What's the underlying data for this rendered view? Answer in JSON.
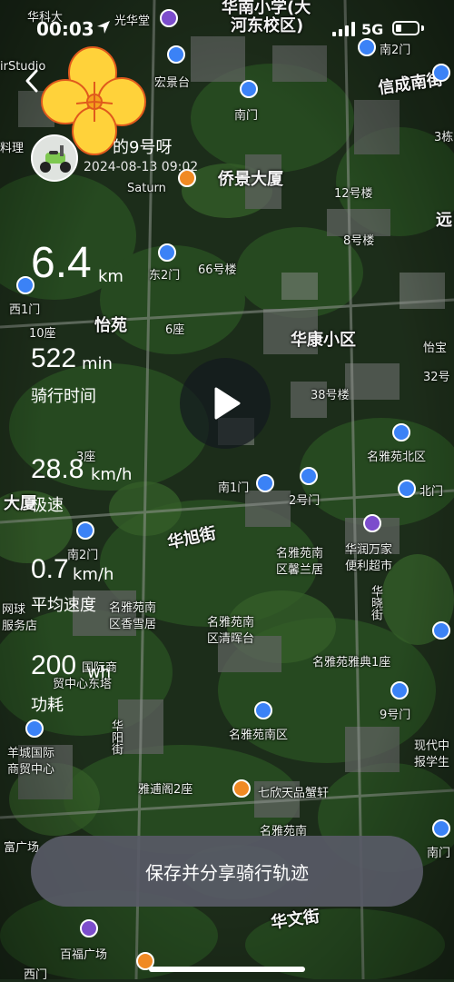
{
  "status_bar": {
    "time": "00:03",
    "network": "5G",
    "battery_level": 0.25
  },
  "header": {
    "user_name": "的9号呀",
    "ride_datetime": "2024-08-13 09:02"
  },
  "stats": [
    {
      "value": "6.4",
      "unit": "km",
      "label": ""
    },
    {
      "value": "522",
      "unit": "min",
      "label": "骑行时间"
    },
    {
      "value": "28.8",
      "unit": "km/h",
      "label": "极速"
    },
    {
      "value": "0.7",
      "unit": "km/h",
      "label": "平均速度"
    },
    {
      "value": "200",
      "unit": "wh",
      "label": "功耗"
    }
  ],
  "actions": {
    "save_share": "保存并分享骑行轨迹"
  },
  "icons": {
    "back": "chevron-left-icon",
    "flower": "flower-sticker-icon",
    "play": "play-icon",
    "location": "location-arrow-icon"
  },
  "colors": {
    "button_bg": "#585a66",
    "map_green": "#2e5a2a",
    "pin_blue": "#3b82f6",
    "pin_orange": "#f08a24",
    "pin_purple": "#7c4dcc"
  },
  "map_labels": {
    "l1": "华科大",
    "l2": "光华堂",
    "l3": "华南小学(大",
    "l4": "河东校区)",
    "l5": "南2门",
    "l6": "宏景台",
    "l7": "信成南街",
    "l8": "南门",
    "l9": "3栋",
    "l10": "料理",
    "l11": "Saturn",
    "l12": "侨景大厦",
    "l13": "12号楼",
    "l14": "远",
    "l15": "8号楼",
    "l16": "东2门",
    "l17": "66号楼",
    "l18": "西1门",
    "l19": "10座",
    "l20": "怡苑",
    "l21": "6座",
    "l22": "华康小区",
    "l23": "怡宝",
    "l24": "32号",
    "l25": "38号楼",
    "l26": "名雅苑北区",
    "l27": "3座",
    "l28": "南1门",
    "l29": "2号门",
    "l30": "北门",
    "l31": "大厦",
    "l32": "华旭街",
    "l33": "南2门",
    "l34": "名雅苑南",
    "l35": "区馨兰居",
    "l36": "华润万家",
    "l37": "便利超市",
    "l38": "网球",
    "l39": "服务店",
    "l40": "名雅苑南",
    "l41": "区香雪居",
    "l42": "名雅苑南",
    "l43": "区清晖台",
    "l44": "华晓街",
    "l45": "国际商",
    "l46": "贸中心东塔",
    "l47": "名雅苑雅典1座",
    "l48": "9号门",
    "l49": "羊城国际",
    "l50": "商贸中心",
    "l51": "华阳街",
    "l52": "名雅苑南区",
    "l53": "现代中",
    "l54": "报学生",
    "l55": "雅逋阁2座",
    "l56": "七欣天品蟹轩",
    "l57": "富广场",
    "l58": "名雅苑南",
    "l59": "南门",
    "l60": "华文街",
    "l61": "百福广场",
    "l62": "西门",
    "l63": "irStudio"
  }
}
